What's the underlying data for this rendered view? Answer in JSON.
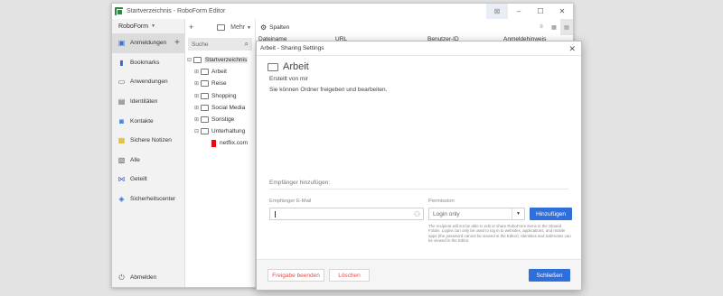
{
  "window": {
    "title": "Startverzeichnis - RoboForm Editor",
    "controls": {
      "pin": "⊠",
      "minimize": "–",
      "maximize": "☐",
      "close": "✕"
    }
  },
  "sidebar": {
    "account": "RoboForm",
    "items": [
      {
        "label": "Anmeldungen",
        "icon": "login-icon"
      },
      {
        "label": "Bookmarks",
        "icon": "bookmark-icon"
      },
      {
        "label": "Anwendungen",
        "icon": "application-icon"
      },
      {
        "label": "Identitäten",
        "icon": "identity-icon"
      },
      {
        "label": "Kontakte",
        "icon": "contact-icon"
      },
      {
        "label": "Sichere Notizen",
        "icon": "note-icon"
      },
      {
        "label": "Alle",
        "icon": "all-icon"
      },
      {
        "label": "Geteilt",
        "icon": "share-icon"
      },
      {
        "label": "Sicherheitscenter",
        "icon": "security-icon"
      }
    ],
    "logout": "Abmelden"
  },
  "tree": {
    "toolbar_more": "Mehr",
    "search_placeholder": "Suche",
    "root": "Startverzeichnis",
    "folders": [
      "Arbeit",
      "Reise",
      "Shopping",
      "Social Media",
      "Sonstige",
      "Unterhaltung"
    ],
    "item": "netflix.com"
  },
  "content": {
    "columns_label": "Spalten",
    "headers": [
      "Dateiname",
      "URL",
      "Benutzer-ID",
      "Anmeldehinweis"
    ]
  },
  "dialog": {
    "title": "Arbeit - Sharing Settings",
    "folder_name": "Arbeit",
    "created_by": "Erstellt von mir",
    "description": "Sie können Ordner freigeben und bearbeiten.",
    "recipients_title": "Empfänger hinzufügen:",
    "email_label": "Empfänger E-Mail",
    "permission_label": "Permission",
    "permission_value": "Login only",
    "add_button": "Hinzufügen",
    "note": "The recipient will not be able to edit or share RoboForm items in the Shared Folder. Logins can only be used to log in to websites, applications, and mobile apps (the password cannot be viewed in the Editor). Identities and Safenotes can be viewed in the Editor.",
    "stop_button": "Freigabe beenden",
    "delete_button": "Löschen",
    "close_button": "Schließen"
  }
}
